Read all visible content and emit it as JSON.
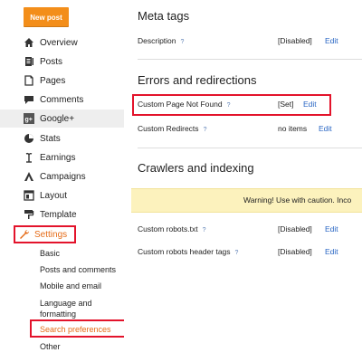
{
  "sidebar": {
    "new_post_label": "New post",
    "items": [
      {
        "label": "Overview",
        "icon": "home-icon"
      },
      {
        "label": "Posts",
        "icon": "posts-icon"
      },
      {
        "label": "Pages",
        "icon": "pages-icon"
      },
      {
        "label": "Comments",
        "icon": "comments-icon"
      },
      {
        "label": "Google+",
        "icon": "google-plus-icon"
      },
      {
        "label": "Stats",
        "icon": "stats-icon"
      },
      {
        "label": "Earnings",
        "icon": "earnings-icon"
      },
      {
        "label": "Campaigns",
        "icon": "campaigns-icon"
      },
      {
        "label": "Layout",
        "icon": "layout-icon"
      },
      {
        "label": "Template",
        "icon": "template-icon"
      },
      {
        "label": "Settings",
        "icon": "wrench-icon"
      }
    ],
    "settings_subitems": [
      "Basic",
      "Posts and comments",
      "Mobile and email",
      "Language and formatting",
      "Search preferences",
      "Other"
    ]
  },
  "main": {
    "meta_tags": {
      "title": "Meta tags",
      "rows": [
        {
          "label": "Description",
          "value": "[Disabled]",
          "edit": "Edit"
        }
      ]
    },
    "errors": {
      "title": "Errors and redirections",
      "rows": [
        {
          "label": "Custom Page Not Found",
          "value": "[Set]",
          "edit": "Edit"
        },
        {
          "label": "Custom Redirects",
          "value": "no items",
          "edit": "Edit"
        }
      ]
    },
    "crawlers": {
      "title": "Crawlers and indexing",
      "warning": "Warning! Use with caution. Inco",
      "rows": [
        {
          "label": "Custom robots.txt",
          "value": "[Disabled]",
          "edit": "Edit"
        },
        {
          "label": "Custom robots header tags",
          "value": "[Disabled]",
          "edit": "Edit"
        }
      ]
    },
    "help_glyph": "?"
  },
  "colors": {
    "new_post": "#f38e1a",
    "highlight_box": "#e3132b",
    "link": "#2a67c4",
    "active_nav": "#e56b17",
    "warning_bg": "#fcf2bd"
  }
}
